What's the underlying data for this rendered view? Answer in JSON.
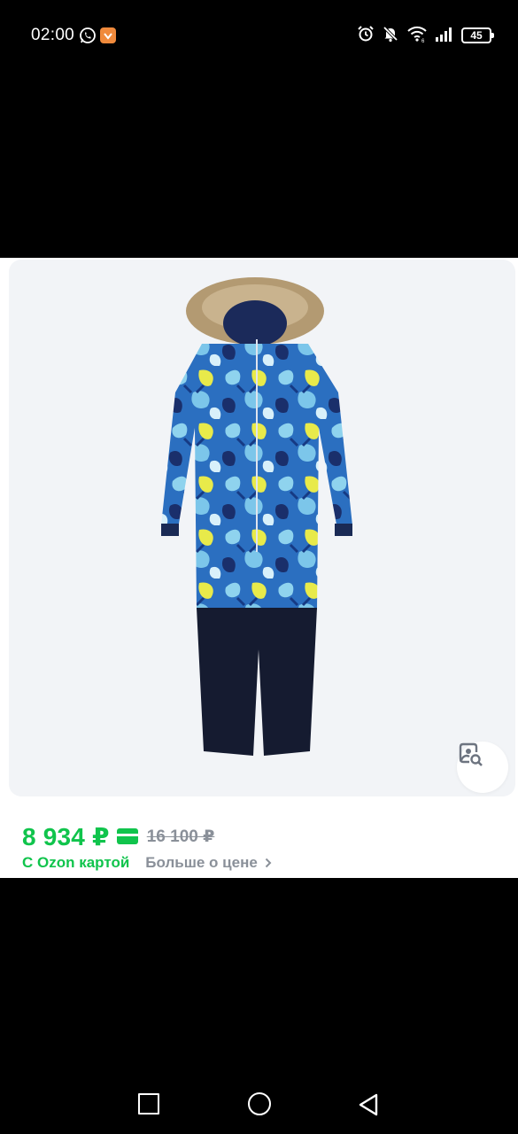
{
  "status_bar": {
    "time": "02:00",
    "left_icons": [
      "whatsapp-icon",
      "notification-app-icon"
    ],
    "right_icons": [
      "alarm-icon",
      "mute-icon",
      "wifi-icon",
      "signal-icon"
    ],
    "battery": "45"
  },
  "product": {
    "image_alt": "Children's winter overall with fur hood, blue and yellow floral print",
    "price": "8 934 ₽",
    "old_price": "16 100 ₽",
    "card_label": "С Ozon картой",
    "more_price_label": "Больше о цене",
    "accent_color": "#10c44c",
    "muted_color": "#8a9099"
  },
  "navigation": {
    "buttons": [
      "recents",
      "home",
      "back"
    ]
  }
}
